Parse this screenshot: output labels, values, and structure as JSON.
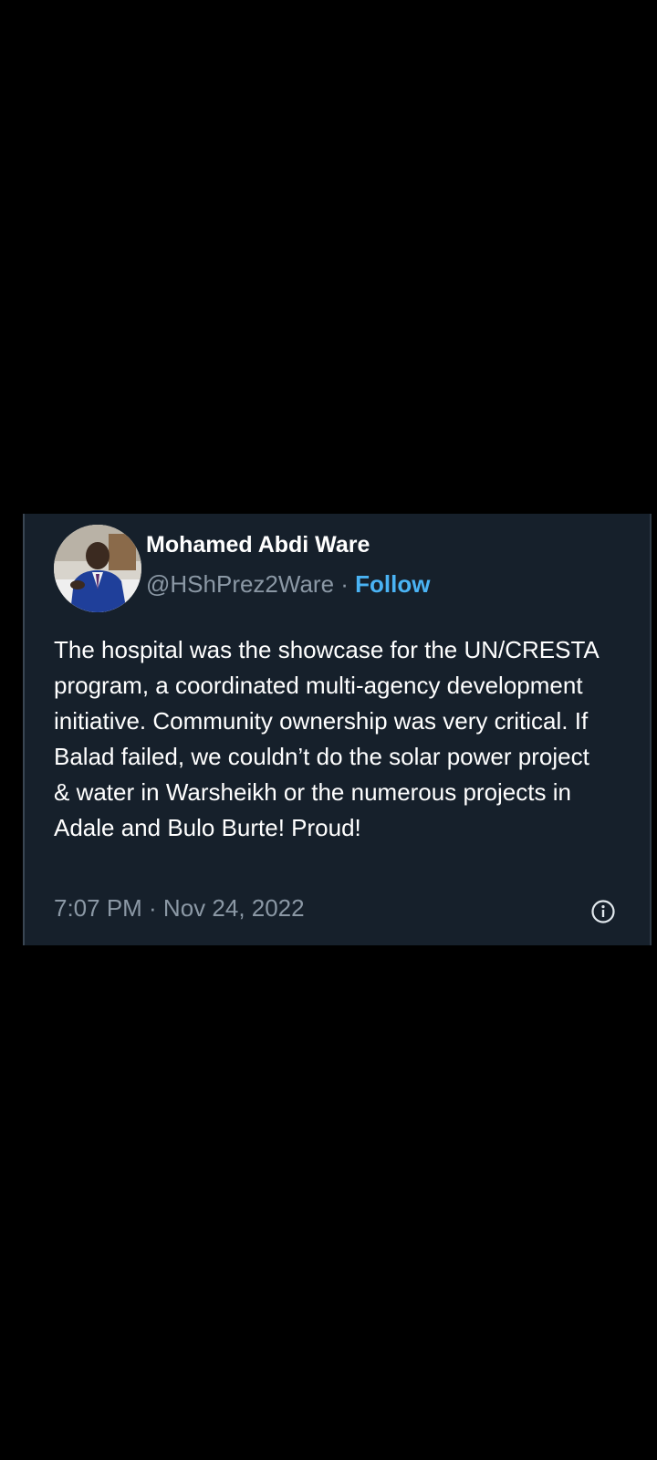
{
  "tweet": {
    "author_name": "Mohamed Abdi Ware",
    "handle": "@HShPrez2Ware",
    "separator": " · ",
    "follow_label": "Follow",
    "text": "The hospital was the showcase for the UN/CRESTA program, a coordinated multi-agency development initiative. Community ownership was very critical. If Balad failed, we couldn’t do the solar power project & water in Warsheikh or the numerous projects in Adale and Bulo Burte! Proud!",
    "timestamp": "7:07 PM · Nov 24, 2022",
    "info_icon": "info-icon"
  },
  "colors": {
    "background": "#000000",
    "card": "#16202b",
    "text_primary": "#ffffff",
    "text_secondary": "#8b98a5",
    "accent": "#4ab3f4"
  }
}
